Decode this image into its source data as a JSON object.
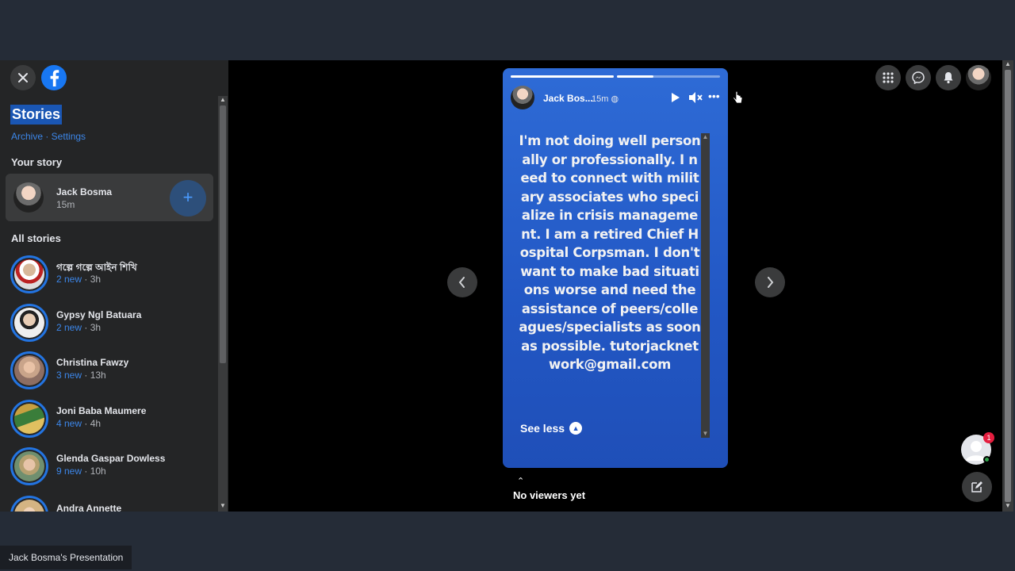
{
  "sidebar": {
    "title": "Stories",
    "archive_settings": "Archive · Settings",
    "your_story_label": "Your story",
    "your_story": {
      "name": "Jack Bosma",
      "time": "15m",
      "add_label": "+"
    },
    "all_stories_label": "All stories",
    "stories": [
      {
        "name": "গল্পে গল্পে আইন শিখি",
        "new": "2 new",
        "time": "3h"
      },
      {
        "name": "Gypsy Ngl Batuara",
        "new": "2 new",
        "time": "3h"
      },
      {
        "name": "Christina Fawzy",
        "new": "3 new",
        "time": "13h"
      },
      {
        "name": "Joni Baba Maumere",
        "new": "4 new",
        "time": "4h"
      },
      {
        "name": "Glenda Gaspar Dowless",
        "new": "9 new",
        "time": "10h"
      },
      {
        "name": "Andra Annette",
        "new": "",
        "time": ""
      }
    ]
  },
  "story": {
    "author": "Jack Bos...",
    "time": "15m",
    "progress": [
      1.0,
      0.35
    ],
    "text": "I'm not doing well personally or professionally. I need to connect with military associates who specialize in crisis management. I am a retired Chief Hospital Corpsman. I don't want to make bad situations worse and need the assistance of peers/colleagues/specialists as soon as possible. tutorjacknetwork@gmail.com",
    "see_less": "See less"
  },
  "viewers": {
    "label": "No viewers yet"
  },
  "chat": {
    "badge": "1"
  },
  "footer": {
    "presentation": "Jack Bosma's Presentation"
  },
  "colors": {
    "accent": "#2374e1",
    "card": "#2257c4",
    "badge": "#e41e3f",
    "online": "#31a24c"
  },
  "icons": {
    "close": "close-icon",
    "logo": "facebook-logo",
    "menu": "grid-menu-icon",
    "messenger": "messenger-icon",
    "notifications": "bell-icon",
    "play": "play-icon",
    "mute": "mute-icon",
    "more": "more-icon"
  }
}
